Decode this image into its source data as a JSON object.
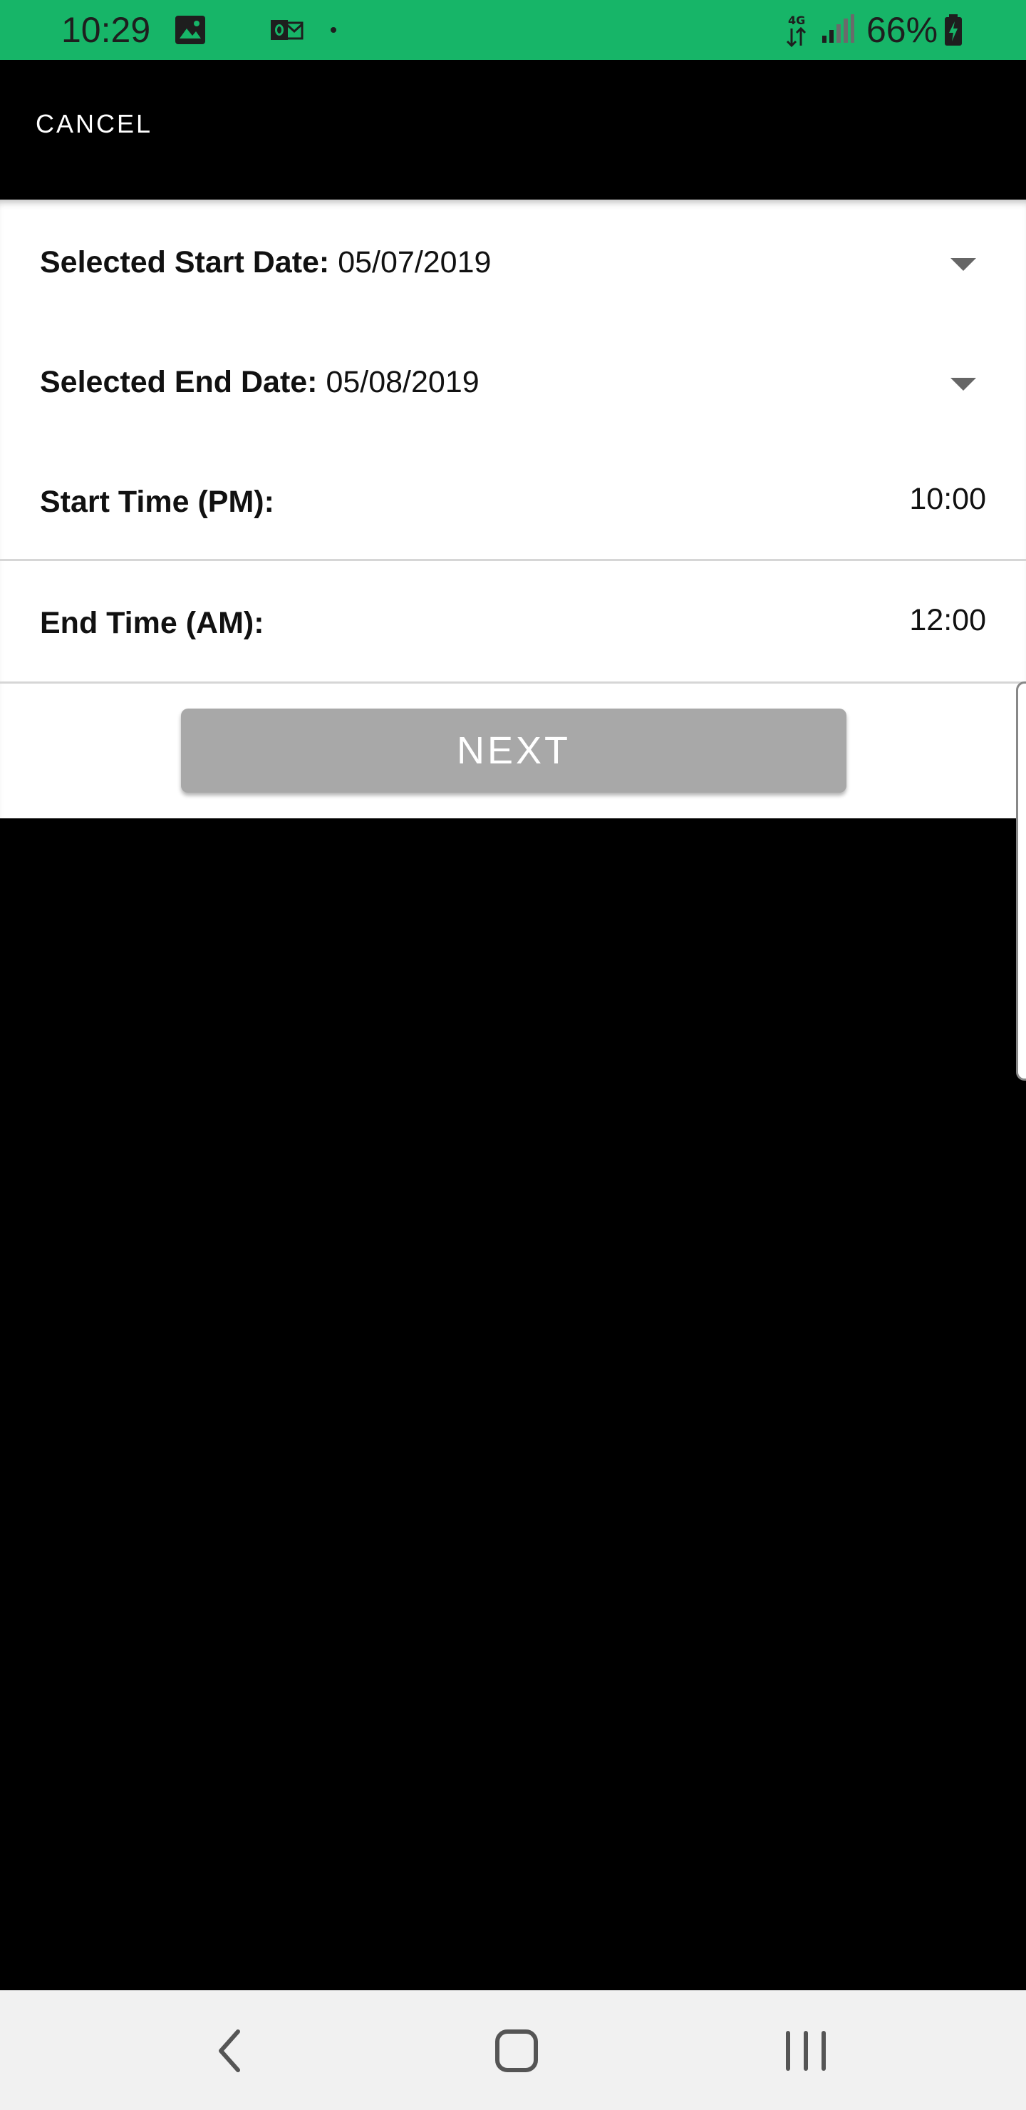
{
  "status_bar": {
    "time": "10:29",
    "battery_percent": "66%",
    "icons": [
      "image-icon",
      "outlook-icon",
      "dot-icon",
      "data-4g-icon",
      "signal-icon",
      "battery-charging-icon"
    ]
  },
  "app_bar": {
    "cancel_label": "CANCEL"
  },
  "form": {
    "start_date": {
      "label": "Selected Start Date:",
      "value": "05/07/2019"
    },
    "end_date": {
      "label": "Selected End Date:",
      "value": "05/08/2019"
    },
    "start_time": {
      "label": "Start Time (PM):",
      "value": "10:00"
    },
    "end_time": {
      "label": "End Time (AM):",
      "value": "12:00"
    },
    "next_label": "NEXT"
  },
  "nav_bar": {
    "icons": [
      "back-icon",
      "home-icon",
      "recents-icon"
    ]
  },
  "colors": {
    "status_bar": "#17b568",
    "next_button": "#a8a8a8"
  }
}
